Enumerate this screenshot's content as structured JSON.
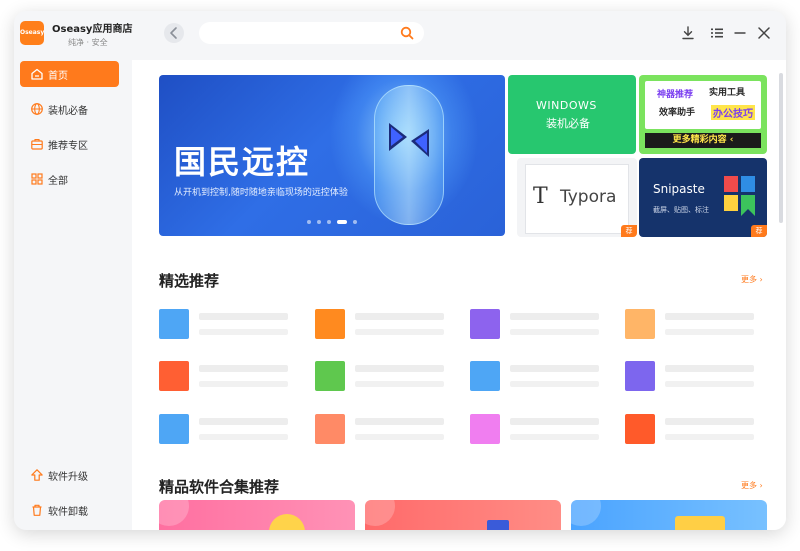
{
  "app": {
    "name": "Oseasy应用商店",
    "subtitle": "纯净 · 安全",
    "logo_text": "Oseasy",
    "accent_color": "#ff7a1c"
  },
  "search": {
    "value": "",
    "placeholder": ""
  },
  "window_controls": [
    "download-icon",
    "menu-icon",
    "minimize-icon",
    "close-icon"
  ],
  "sidebar": {
    "items": [
      {
        "label": "首页",
        "icon": "home-icon",
        "active": true
      },
      {
        "label": "装机必备",
        "icon": "globe-icon",
        "active": false
      },
      {
        "label": "推荐专区",
        "icon": "briefcase-icon",
        "active": false
      },
      {
        "label": "全部",
        "icon": "grid-icon",
        "active": false
      }
    ],
    "bottom_items": [
      {
        "label": "软件升级",
        "icon": "upgrade-icon"
      },
      {
        "label": "软件卸载",
        "icon": "trash-icon"
      }
    ]
  },
  "banner": {
    "title": "国民远控",
    "subtitle": "从开机到控制,随时随地亲临现场的远控体验",
    "slide_count": 5,
    "active_slide": 4
  },
  "tiles": {
    "windows": {
      "line1": "WINDOWS",
      "line2": "装机必备"
    },
    "tips": {
      "a": "神器推荐",
      "b": "实用工具",
      "c": "效率助手",
      "d": "办公技巧",
      "bar": "更多精彩内容 ‹"
    },
    "typora": {
      "letter": "T",
      "name": "Typora",
      "badge": "荐"
    },
    "snipaste": {
      "name": "Snipaste",
      "sub": "截屏、贴图、标注",
      "badge": "荐"
    }
  },
  "sections": {
    "featured": {
      "title": "精选推荐",
      "more": "更多 ›"
    },
    "collections": {
      "title": "精品软件合集推荐",
      "more": "更多 ›"
    }
  },
  "featured_apps": [
    {
      "color": "#4ea6f5"
    },
    {
      "color": "#ff8a1f"
    },
    {
      "color": "#8d63ee"
    },
    {
      "color": "#ffb567"
    },
    {
      "color": "#ff5f33"
    },
    {
      "color": "#5fc84e"
    },
    {
      "color": "#4ea6f5"
    },
    {
      "color": "#7d66ee"
    },
    {
      "color": "#4ea6f5"
    },
    {
      "color": "#ff8a66"
    },
    {
      "color": "#f07ef0"
    },
    {
      "color": "#ff5a2a"
    }
  ]
}
